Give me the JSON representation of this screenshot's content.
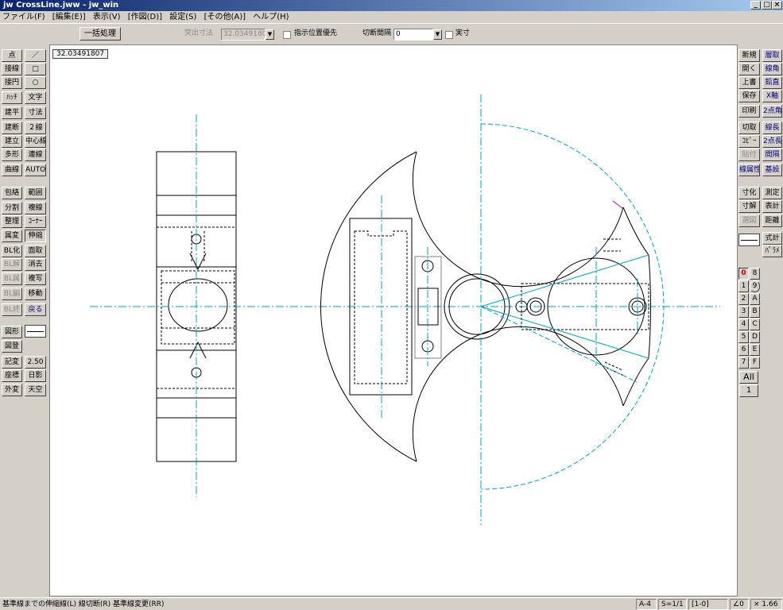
{
  "window": {
    "title": "jw CrossLine.jww - jw_win",
    "min": "_",
    "max": "□",
    "close": "×"
  },
  "menu": [
    "ファイル(F)",
    "[編集(E)]",
    "表示(V)",
    "[作図(D)]",
    "設定(S)",
    "[その他(A)]",
    "ヘルプ(H)"
  ],
  "toolbar": {
    "batch_label": "一括処理",
    "protrusion_label": "突出寸法",
    "protrusion_value": "32.03491807",
    "point_priority_label": "指示位置優先",
    "cut_gap_label": "切断間隔",
    "cut_gap_value": "0",
    "actual_label": "実寸"
  },
  "coord_readout": "32.03491807",
  "left_tools": [
    [
      "点",
      "／"
    ],
    [
      "接線",
      "□"
    ],
    [
      "接円",
      "○"
    ],
    [
      "ﾊｯﾁ",
      "文字"
    ],
    [
      "建平",
      "寸法"
    ],
    [
      "建断",
      "２線"
    ],
    [
      "建立",
      "中心線"
    ],
    [
      "多形",
      "連線"
    ],
    [
      "曲線",
      "AUTO"
    ],
    [
      "包絡",
      "範囲"
    ],
    [
      "分割",
      "複線"
    ],
    [
      "整理",
      "ｺｰﾅｰ"
    ],
    [
      "属変",
      "伸縮"
    ],
    [
      "BL化",
      "面取"
    ],
    [
      "BL解",
      "消去"
    ],
    [
      "BL属",
      "複写"
    ],
    [
      "BL編",
      "移動"
    ],
    [
      "BL終",
      "戻る"
    ],
    [
      "図形",
      ""
    ],
    [
      "図登",
      ""
    ],
    [
      "記変",
      "2.50"
    ],
    [
      "座標",
      "日影"
    ],
    [
      "外変",
      "天空"
    ]
  ],
  "right_tools": [
    [
      "新規",
      "層取"
    ],
    [
      "開く",
      "線角"
    ],
    [
      "上書",
      "鉛直"
    ],
    [
      "保存",
      "X軸"
    ],
    [
      "印刷",
      "2点角"
    ],
    [
      "切取",
      "線長"
    ],
    [
      "ｺﾋﾟｰ",
      "2点長"
    ],
    [
      "貼付",
      "間隔"
    ],
    [
      "線属性",
      "基設"
    ],
    [
      "寸化",
      "測定"
    ],
    [
      "寸解",
      "表計"
    ],
    [
      "選図",
      "距離"
    ],
    [
      "",
      "式計"
    ],
    [
      "",
      "ﾊﾟﾗﾒ"
    ]
  ],
  "layers": [
    [
      "0",
      "8"
    ],
    [
      "1",
      "9"
    ],
    [
      "2",
      "A"
    ],
    [
      "3",
      "B"
    ],
    [
      "4",
      "C"
    ],
    [
      "5",
      "D"
    ],
    [
      "6",
      "E"
    ],
    [
      "7",
      "F"
    ]
  ],
  "layer_all": "All",
  "layer_group": "1",
  "status": {
    "message": "基準線までの伸縮線(L)  線切断(R)  基準線変更(RR)",
    "paper": "A-4",
    "scale": "S=1/1",
    "group": "[1-0]",
    "angle": "∠0",
    "zoom": "× 1.66"
  },
  "colors": {
    "centerline": "#00a0c8",
    "drawing": "#000000",
    "aux": "#606060"
  }
}
